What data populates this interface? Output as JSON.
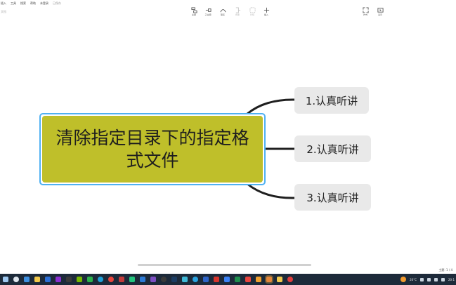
{
  "menu": {
    "items": [
      "插入",
      "工具",
      "搜索",
      "帮助",
      "未登录"
    ],
    "saved_status": "已保存"
  },
  "doc": {
    "name": "文档"
  },
  "toolbar": {
    "tools": [
      {
        "name": "topic",
        "label": "主题",
        "icon": "topic-icon",
        "enabled": true
      },
      {
        "name": "subtopic",
        "label": "子主题",
        "icon": "subtopic-icon",
        "enabled": true
      },
      {
        "name": "relation",
        "label": "联系",
        "icon": "relation-icon",
        "enabled": true
      },
      {
        "name": "summary",
        "label": "概要",
        "icon": "summary-icon",
        "enabled": false
      },
      {
        "name": "outline",
        "label": "外框",
        "icon": "outline-icon",
        "enabled": false
      },
      {
        "name": "insert",
        "label": "插入",
        "icon": "plus-icon",
        "enabled": true
      },
      {
        "name": "zen",
        "label": "ZEN",
        "icon": "fullscreen-icon",
        "enabled": true
      },
      {
        "name": "present",
        "label": "演示",
        "icon": "present-icon",
        "enabled": true
      }
    ]
  },
  "mindmap": {
    "central": "清除指定目录下的指定格式文件",
    "central_color": "#bfbf2a",
    "selection_color": "#4fb1f2",
    "branches": [
      "1.认真听讲",
      "2.认真听讲",
      "3.认真听讲"
    ]
  },
  "statusbar": {
    "page": "主题: 1 / 4"
  },
  "taskbar": {
    "apps": [
      "windows-icon",
      "search-icon",
      "folder-icon",
      "file-explorer-icon",
      "photoshop-icon",
      "premiere-icon",
      "terminal-icon",
      "nvidia-icon",
      "wechat-icon",
      "edge-icon",
      "chrome-icon",
      "app-icon",
      "pycharm-icon",
      "vscode-icon",
      "visual-studio-icon",
      "git-icon",
      "steam-icon",
      "app2-icon",
      "telegram-icon",
      "app3-icon",
      "netease-icon",
      "app4-icon",
      "app5-icon",
      "app6-icon",
      "app7-icon",
      "xmind-icon",
      "folder2-icon",
      "record-icon"
    ],
    "temperature": "20°C",
    "time": "20:1"
  }
}
